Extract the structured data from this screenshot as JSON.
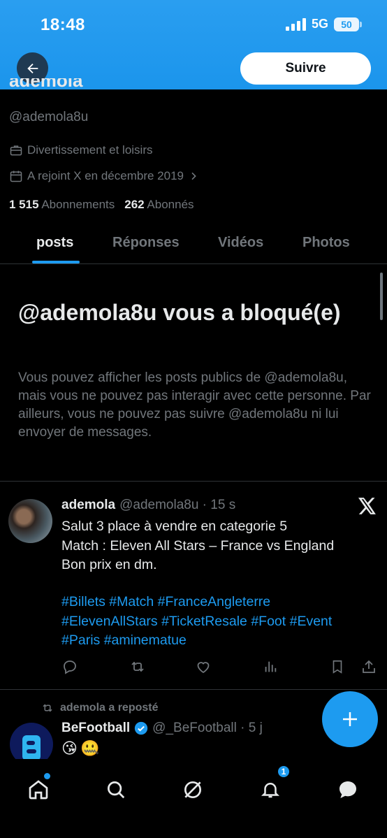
{
  "status": {
    "time": "18:48",
    "network": "5G",
    "battery": "50"
  },
  "header": {
    "follow_label": "Suivre"
  },
  "profile": {
    "name": "ademola",
    "handle": "@ademola8u",
    "category": "Divertissement et loisirs",
    "joined": "A rejoint X en décembre 2019",
    "following_count": "1 515",
    "following_label": "Abonnements",
    "followers_count": "262",
    "followers_label": "Abonnés"
  },
  "tabs": [
    {
      "label": "posts",
      "active": true
    },
    {
      "label": "Réponses",
      "active": false
    },
    {
      "label": "Vidéos",
      "active": false
    },
    {
      "label": "Photos",
      "active": false
    }
  ],
  "blocked": {
    "title": "@ademola8u vous a bloqué(e)",
    "body": "Vous pouvez afficher les posts publics de @ademola8u, mais vous ne pouvez pas interagir avec cette personne. Par ailleurs, vous ne pouvez pas suivre @ademola8u ni lui envoyer de messages."
  },
  "post": {
    "name": "ademola",
    "handle_time": "@ademola8u · 15 s",
    "lines": [
      "Salut 3 place à vendre en categorie 5",
      "Match : Eleven All Stars – France vs England",
      "Bon prix en dm."
    ],
    "hashtag_lines": [
      "#Billets #Match #FranceAngleterre",
      "#ElevenAllStars #TicketResale #Foot #Event",
      "#Paris #aminematue"
    ]
  },
  "repost": {
    "label": "ademola a reposté",
    "name": "BeFootball",
    "handle_time": "@_BeFootball · 5 j",
    "emojis": [
      "😘",
      "🤐"
    ]
  },
  "nav": {
    "notifications_badge": "1"
  },
  "colors": {
    "accent": "#1d9bf0",
    "muted": "#71767b",
    "text": "#e7e9ea",
    "bg": "#000000"
  }
}
